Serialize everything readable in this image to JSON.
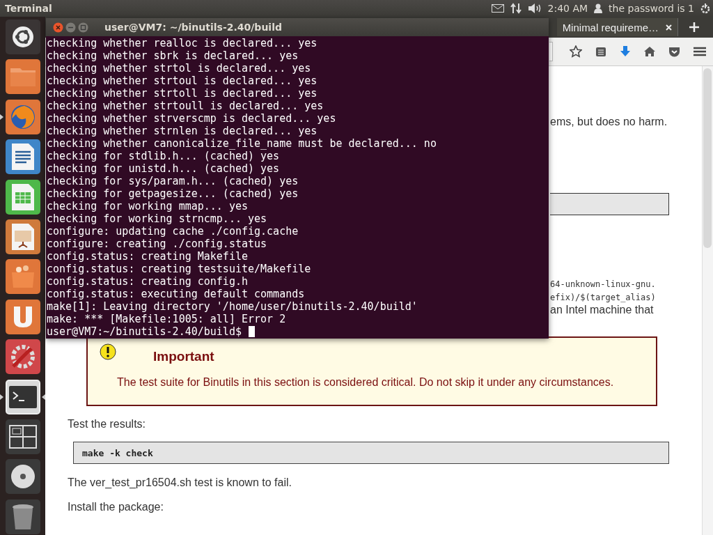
{
  "top_panel": {
    "app_name": "Terminal",
    "clock": "2:40 AM",
    "user": "the password is 1"
  },
  "launcher": [
    {
      "kind": "ubuntu",
      "running": false,
      "focused": false
    },
    {
      "kind": "files",
      "running": false,
      "focused": false
    },
    {
      "kind": "firefox",
      "running": true,
      "focused": false
    },
    {
      "kind": "writer",
      "running": false,
      "focused": false
    },
    {
      "kind": "calc",
      "running": false,
      "focused": false
    },
    {
      "kind": "impress",
      "running": false,
      "focused": false
    },
    {
      "kind": "store",
      "running": false,
      "focused": false
    },
    {
      "kind": "ubuntuone",
      "running": false,
      "focused": false
    },
    {
      "kind": "settings",
      "running": false,
      "focused": false
    },
    {
      "kind": "terminal",
      "running": true,
      "focused": true
    },
    {
      "kind": "workspaces",
      "running": false,
      "focused": false
    },
    {
      "kind": "disc",
      "running": false,
      "focused": false
    },
    {
      "kind": "trash",
      "running": false,
      "focused": false
    }
  ],
  "browser": {
    "tab": {
      "title": "Minimal requireme…"
    },
    "page": {
      "fragment_1": "ems, but does no harm.",
      "fragment_2": "64-unknown-linux-gnu.",
      "fragment_3": "efix)/$(target_alias)",
      "fragment_4": "an Intel machine that",
      "important": {
        "title": "Important",
        "text": "The test suite for Binutils in this section is considered critical. Do not skip it under any circumstances."
      },
      "test_label": "Test the results:",
      "test_command": "make -k check",
      "note": "The ver_test_pr16504.sh test is known to fail.",
      "install_label": "Install the package:"
    }
  },
  "terminal": {
    "title": "user@VM7: ~/binutils-2.40/build",
    "lines": [
      "checking whether realloc is declared... yes",
      "checking whether sbrk is declared... yes",
      "checking whether strtol is declared... yes",
      "checking whether strtoul is declared... yes",
      "checking whether strtoll is declared... yes",
      "checking whether strtoull is declared... yes",
      "checking whether strverscmp is declared... yes",
      "checking whether strnlen is declared... yes",
      "checking whether canonicalize_file_name must be declared... no",
      "checking for stdlib.h... (cached) yes",
      "checking for unistd.h... (cached) yes",
      "checking for sys/param.h... (cached) yes",
      "checking for getpagesize... (cached) yes",
      "checking for working mmap... yes",
      "checking for working strncmp... yes",
      "configure: updating cache ./config.cache",
      "configure: creating ./config.status",
      "config.status: creating Makefile",
      "config.status: creating testsuite/Makefile",
      "config.status: creating config.h",
      "config.status: executing default commands",
      "make[1]: Leaving directory '/home/user/binutils-2.40/build'",
      "make: *** [Makefile:1005: all] Error 2"
    ],
    "prompt": "user@VM7:~/binutils-2.40/build$"
  }
}
